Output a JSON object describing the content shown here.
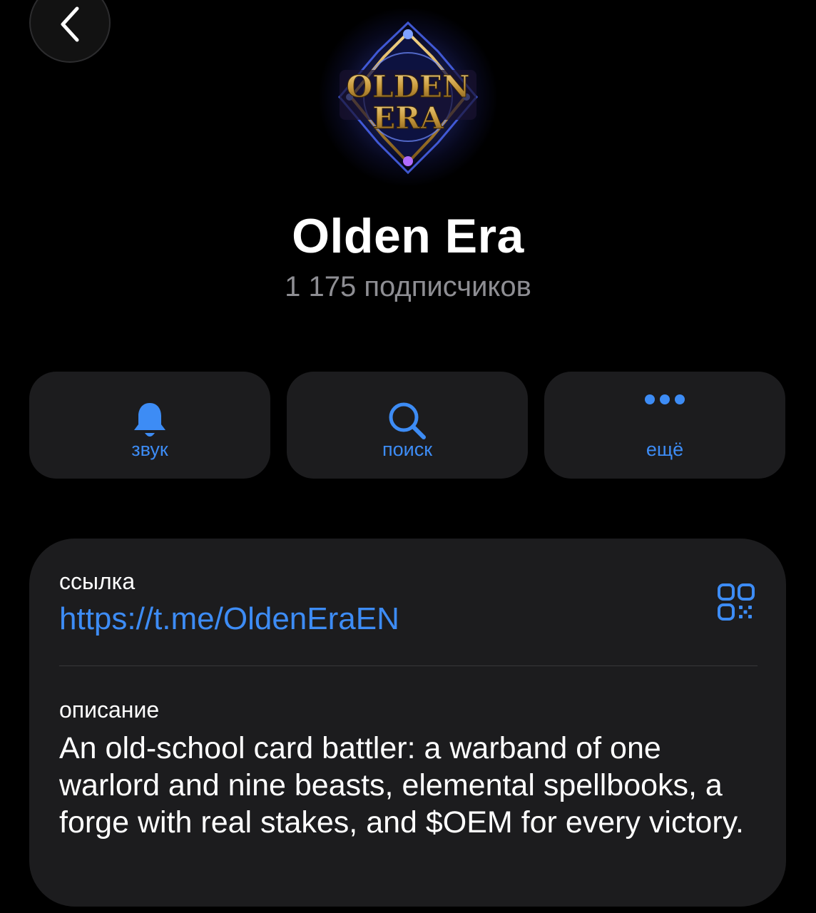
{
  "header": {
    "back_icon": "chevron-left-icon"
  },
  "channel": {
    "title": "Olden Era",
    "subscribers": "1 175 подписчиков",
    "avatar_logo_text": "OLDEN ERA"
  },
  "actions": [
    {
      "label": "звук",
      "icon": "bell-icon"
    },
    {
      "label": "поиск",
      "icon": "search-icon"
    },
    {
      "label": "ещё",
      "icon": "more-dots-icon"
    }
  ],
  "info": {
    "link_label": "ссылка",
    "link_value": "https://t.me/OldenEraEN",
    "qr_icon": "qr-code-icon",
    "description_label": "описание",
    "description_text": "An old-school card battler: a warband of one warlord and nine beasts, elemental spellbooks, a forge with real stakes, and $OEM for every victory."
  },
  "colors": {
    "background": "#000000",
    "card": "#1c1c1e",
    "accent": "#3d8cf5",
    "secondary_text": "#8e8e93"
  }
}
